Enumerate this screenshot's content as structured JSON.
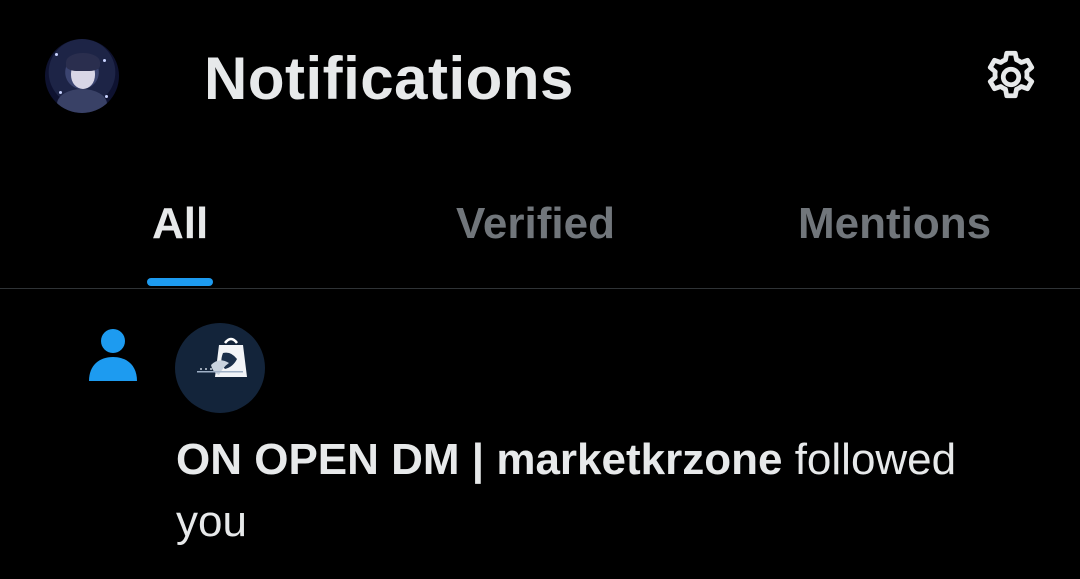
{
  "header": {
    "title": "Notifications",
    "avatar_icon": "profile-avatar",
    "settings_icon": "gear-icon"
  },
  "tabs": [
    {
      "label": "All",
      "active": true
    },
    {
      "label": "Verified",
      "active": false
    },
    {
      "label": "Mentions",
      "active": false
    }
  ],
  "notifications": [
    {
      "type_icon": "person-icon",
      "avatar_icon": "shopping-bag-logo-avatar",
      "display_name": "ON OPEN DM | marketkrzone",
      "action": " followed you"
    }
  ],
  "colors": {
    "background": "#000000",
    "text_primary": "#e7e9ea",
    "text_secondary": "#71767b",
    "accent": "#1d9bf0",
    "divider": "#2f3336"
  }
}
